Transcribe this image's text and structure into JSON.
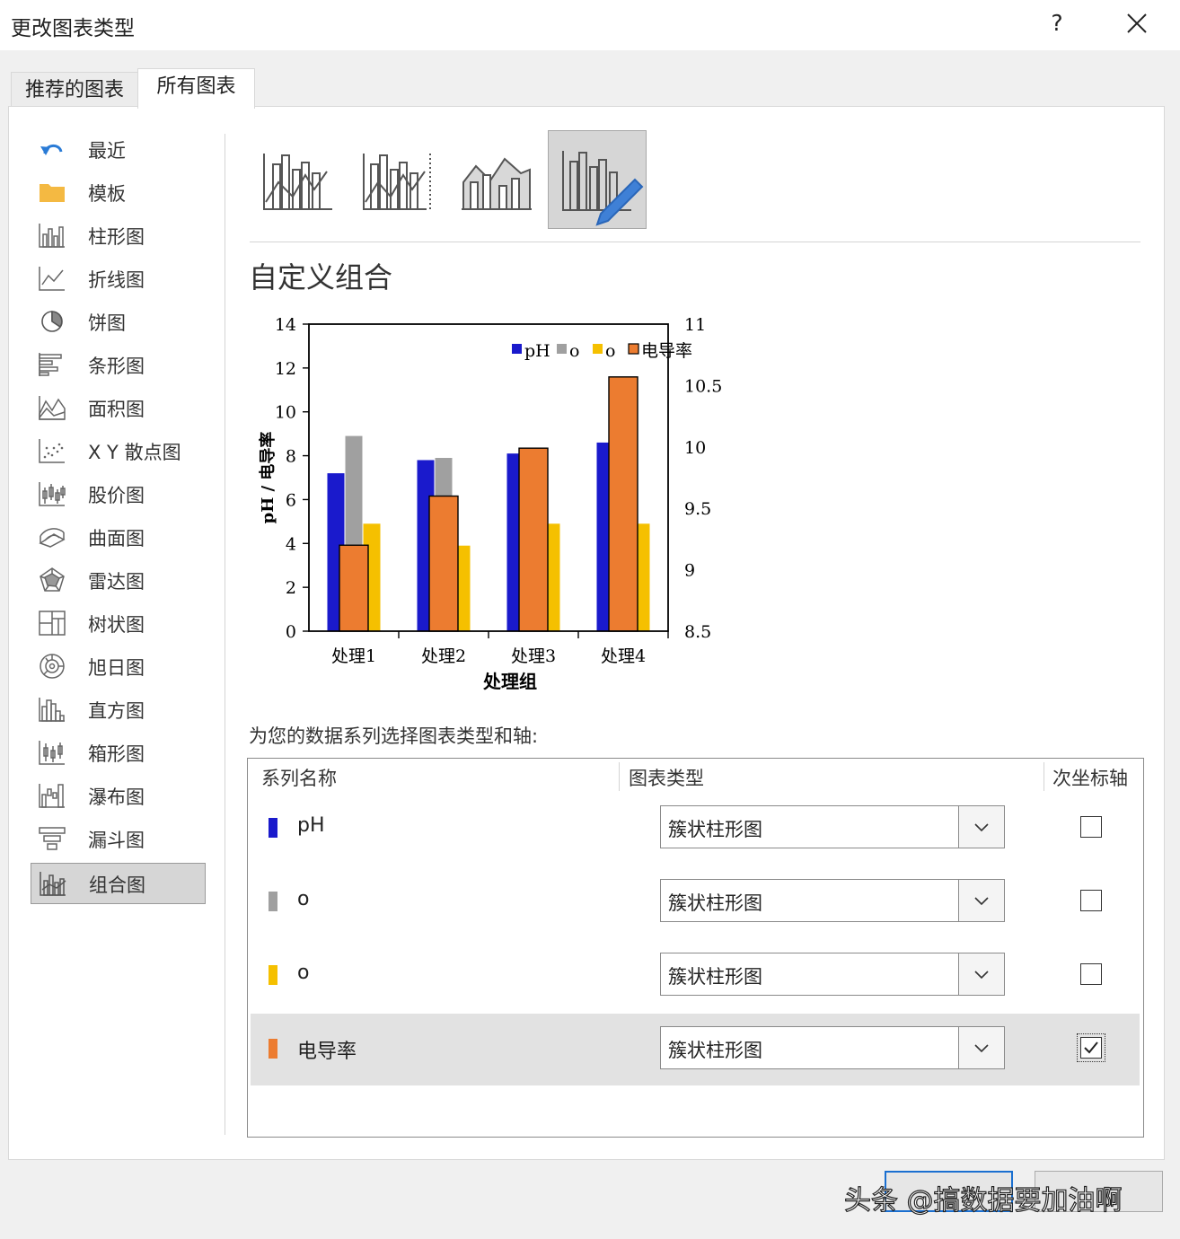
{
  "dialog": {
    "title": "更改图表类型",
    "help": "?"
  },
  "tabs": [
    {
      "label": "推荐的图表"
    },
    {
      "label": "所有图表"
    }
  ],
  "sidebar": {
    "items": [
      {
        "label": "最近",
        "icon": "undo-icon"
      },
      {
        "label": "模板",
        "icon": "folder-icon"
      },
      {
        "label": "柱形图",
        "icon": "column-chart-icon"
      },
      {
        "label": "折线图",
        "icon": "line-chart-icon"
      },
      {
        "label": "饼图",
        "icon": "pie-chart-icon"
      },
      {
        "label": "条形图",
        "icon": "bar-chart-icon"
      },
      {
        "label": "面积图",
        "icon": "area-chart-icon"
      },
      {
        "label": "X Y 散点图",
        "icon": "scatter-chart-icon"
      },
      {
        "label": "股价图",
        "icon": "stock-chart-icon"
      },
      {
        "label": "曲面图",
        "icon": "surface-chart-icon"
      },
      {
        "label": "雷达图",
        "icon": "radar-chart-icon"
      },
      {
        "label": "树状图",
        "icon": "treemap-icon"
      },
      {
        "label": "旭日图",
        "icon": "sunburst-icon"
      },
      {
        "label": "直方图",
        "icon": "histogram-icon"
      },
      {
        "label": "箱形图",
        "icon": "box-whisker-icon"
      },
      {
        "label": "瀑布图",
        "icon": "waterfall-icon"
      },
      {
        "label": "漏斗图",
        "icon": "funnel-icon"
      },
      {
        "label": "组合图",
        "icon": "combo-chart-icon"
      }
    ]
  },
  "section_title": "自定义组合",
  "chart_data": {
    "type": "bar",
    "categories": [
      "处理1",
      "处理2",
      "处理3",
      "处理4"
    ],
    "xlabel": "处理组",
    "ylabel": "pH / 电导率",
    "ylim": [
      0,
      14
    ],
    "yticks": [
      "0",
      "2",
      "4",
      "6",
      "8",
      "10",
      "12",
      "14"
    ],
    "y2lim": [
      8.5,
      11
    ],
    "y2ticks": [
      "8.5",
      "9",
      "9.5",
      "10",
      "10.5",
      "11"
    ],
    "legend_position": "top-right",
    "grid": false,
    "series": [
      {
        "name": "pH",
        "color": "#1a1acc",
        "axis": "primary",
        "values": [
          7.2,
          7.8,
          8.1,
          8.6
        ]
      },
      {
        "name": "o",
        "color": "#a0a0a0",
        "axis": "primary",
        "values": [
          8.9,
          7.9,
          0,
          0
        ]
      },
      {
        "name": "o",
        "color": "#f5c000",
        "axis": "primary",
        "values": [
          4.9,
          3.9,
          4.9,
          4.9
        ]
      },
      {
        "name": "电导率",
        "color": "#ec7c30",
        "axis": "secondary",
        "values": [
          9.2,
          9.6,
          9.99,
          10.57
        ]
      }
    ]
  },
  "series_table": {
    "instruction": "为您的数据系列选择图表类型和轴:",
    "headers": {
      "name": "系列名称",
      "type": "图表类型",
      "secondary": "次坐标轴"
    },
    "rows": [
      {
        "name": "pH",
        "color": "#1a1acc",
        "type": "簇状柱形图",
        "secondary": false
      },
      {
        "name": "o",
        "color": "#a0a0a0",
        "type": "簇状柱形图",
        "secondary": false
      },
      {
        "name": "o",
        "color": "#f5c000",
        "type": "簇状柱形图",
        "secondary": false
      },
      {
        "name": "电导率",
        "color": "#ec7c30",
        "type": "簇状柱形图",
        "secondary": true
      }
    ]
  },
  "watermark": "头条 @搞数据要加油啊"
}
